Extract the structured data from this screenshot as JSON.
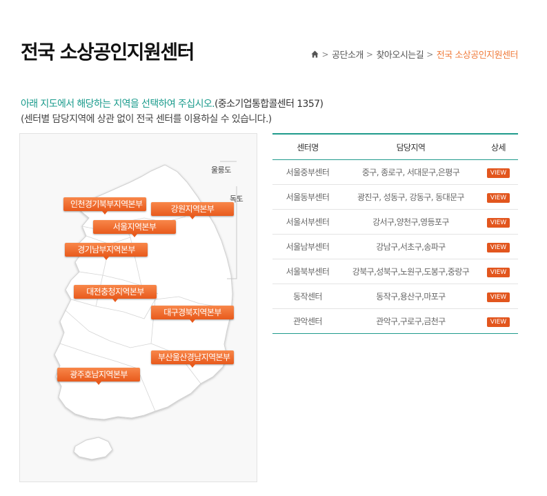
{
  "page": {
    "title": "전국 소상공인지원센터"
  },
  "breadcrumb": {
    "icon": "home-icon",
    "items": [
      "공단소개",
      "찾아오시는길"
    ],
    "current": "전국 소상공인지원센터",
    "accent_color": "#f07c3c"
  },
  "intro": {
    "highlight": "아래 지도에서 해당하는 지역을 선택하여 주십시오.",
    "phone": "(중소기업통합콜센터 1357)",
    "note": "(센터별 담당지역에 상관 없이 전국 센터를 이용하실 수 있습니다.)"
  },
  "map": {
    "islands": [
      "울릉도",
      "독도"
    ],
    "regions": [
      {
        "label": "인천경기북부지역본부"
      },
      {
        "label": "강원지역본부"
      },
      {
        "label": "서울지역본부"
      },
      {
        "label": "경기남부지역본부"
      },
      {
        "label": "대전충청지역본부"
      },
      {
        "label": "대구경북지역본부"
      },
      {
        "label": "부산울산경남지역본부"
      },
      {
        "label": "광주호남지역본부"
      }
    ]
  },
  "table": {
    "headers": [
      "센터명",
      "담당지역",
      "상세"
    ],
    "view_label": "VIEW",
    "accent_color": "#1e9a8b",
    "rows": [
      {
        "name": "서울중부센터",
        "area": "중구, 종로구, 서대문구,은평구"
      },
      {
        "name": "서울동부센터",
        "area": "광진구, 성동구, 강동구, 동대문구"
      },
      {
        "name": "서울서부센터",
        "area": "강서구,양천구,영등포구"
      },
      {
        "name": "서울남부센터",
        "area": "강남구,서초구,송파구"
      },
      {
        "name": "서울북부센터",
        "area": "강북구,성북구,노원구,도봉구,중랑구"
      },
      {
        "name": "동작센터",
        "area": "동작구,용산구,마포구"
      },
      {
        "name": "관악센터",
        "area": "관악구,구로구,금천구"
      }
    ]
  }
}
